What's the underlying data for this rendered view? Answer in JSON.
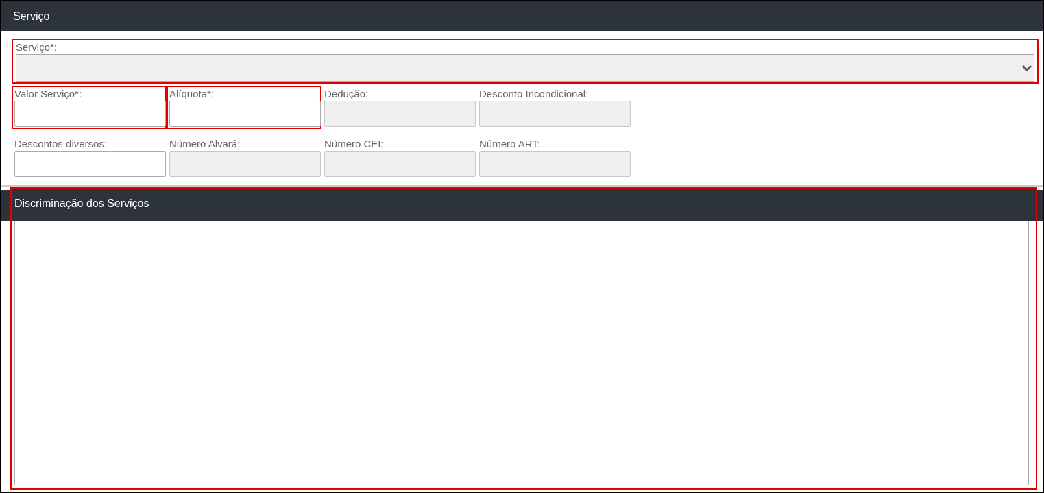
{
  "panel": {
    "title": "Serviço"
  },
  "service_select": {
    "label": "Serviço*:",
    "disabled": true,
    "highlighted": true
  },
  "field_rows": [
    [
      {
        "label": "Valor Serviço*:",
        "disabled": false,
        "highlighted": true
      },
      {
        "label": "Alíquota*:",
        "disabled": false,
        "highlighted": true
      },
      {
        "label": "Dedução:",
        "disabled": true,
        "highlighted": false
      },
      {
        "label": "Desconto Incondicional:",
        "disabled": true,
        "highlighted": false
      }
    ],
    [
      {
        "label": "Descontos diversos:",
        "disabled": false,
        "highlighted": false
      },
      {
        "label": "Número Alvará:",
        "disabled": true,
        "highlighted": false
      },
      {
        "label": "Número CEI:",
        "disabled": true,
        "highlighted": false
      },
      {
        "label": "Número ART:",
        "disabled": true,
        "highlighted": false
      }
    ]
  ],
  "description": {
    "title": "Discriminação dos Serviços",
    "highlighted": true
  }
}
